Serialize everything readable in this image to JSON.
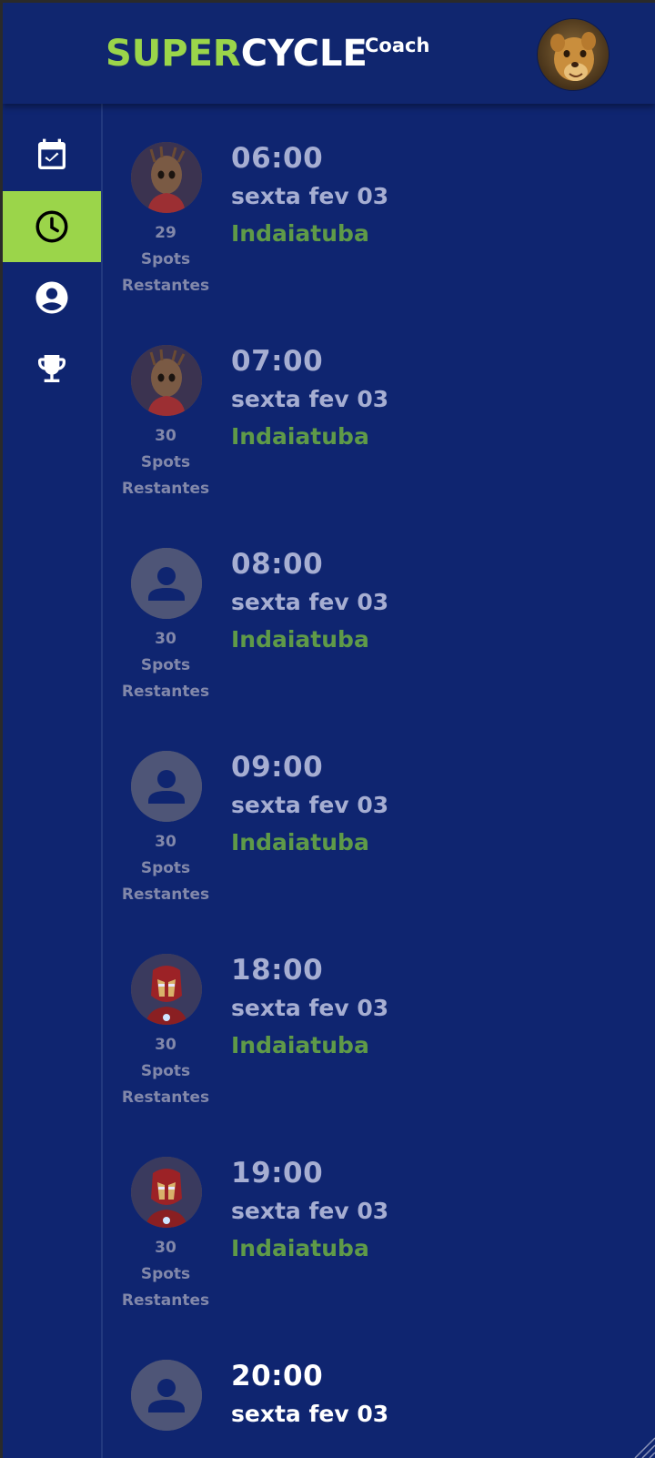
{
  "header": {
    "brand_part1": "SUPER",
    "brand_part2": "CYCLE",
    "brand_suffix": "Coach",
    "avatar": "lion-cub-avatar"
  },
  "sidebar": {
    "items": [
      {
        "name": "calendar",
        "icon": "calendar-check-icon",
        "active": false
      },
      {
        "name": "history",
        "icon": "clock-icon",
        "active": true
      },
      {
        "name": "profile",
        "icon": "account-circle-icon",
        "active": false
      },
      {
        "name": "ranking",
        "icon": "trophy-icon",
        "active": false
      }
    ]
  },
  "classes": [
    {
      "time": "06:00",
      "date": "sexta fev 03",
      "location": "Indaiatuba",
      "spots_count": "29",
      "spots_word": "Spots",
      "spots_label": "Restantes",
      "instructor_avatar": "groot-avatar"
    },
    {
      "time": "07:00",
      "date": "sexta fev 03",
      "location": "Indaiatuba",
      "spots_count": "30",
      "spots_word": "Spots",
      "spots_label": "Restantes",
      "instructor_avatar": "groot-avatar"
    },
    {
      "time": "08:00",
      "date": "sexta fev 03",
      "location": "Indaiatuba",
      "spots_count": "30",
      "spots_word": "Spots",
      "spots_label": "Restantes",
      "instructor_avatar": "person-icon"
    },
    {
      "time": "09:00",
      "date": "sexta fev 03",
      "location": "Indaiatuba",
      "spots_count": "30",
      "spots_word": "Spots",
      "spots_label": "Restantes",
      "instructor_avatar": "person-icon"
    },
    {
      "time": "18:00",
      "date": "sexta fev 03",
      "location": "Indaiatuba",
      "spots_count": "30",
      "spots_word": "Spots",
      "spots_label": "Restantes",
      "instructor_avatar": "iron-man-avatar"
    },
    {
      "time": "19:00",
      "date": "sexta fev 03",
      "location": "Indaiatuba",
      "spots_count": "30",
      "spots_word": "Spots",
      "spots_label": "Restantes",
      "instructor_avatar": "iron-man-avatar"
    },
    {
      "time": "20:00",
      "date": "sexta fev 03",
      "location": "",
      "spots_count": "",
      "spots_word": "",
      "spots_label": "",
      "instructor_avatar": "person-icon"
    }
  ],
  "colors": {
    "background": "#0f2570",
    "accent": "#9bd54a",
    "location": "#5f9a48",
    "muted_text": "#a6aed2"
  }
}
